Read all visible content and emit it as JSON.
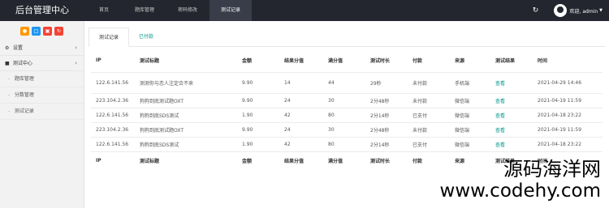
{
  "header": {
    "brand": "后台管理中心",
    "nav": [
      {
        "label": "首页",
        "active": false
      },
      {
        "label": "题库管理",
        "active": false
      },
      {
        "label": "密码修改",
        "active": false
      },
      {
        "label": "测试记录",
        "active": true
      }
    ],
    "user": "欢迎, admin",
    "refresh_icon": "refresh-icon",
    "avatar_icon": "avatar-icon"
  },
  "sidebar": {
    "quick_buttons": [
      {
        "icon": "user-icon",
        "color": "#ff9800"
      },
      {
        "icon": "document-icon",
        "color": "#2196f3"
      },
      {
        "icon": "copy-icon",
        "color": "#f44336"
      },
      {
        "icon": "refresh-icon",
        "color": "#f44336"
      }
    ],
    "menu": [
      {
        "label": "设置",
        "icon": "gears-icon"
      },
      {
        "label": "测试中心",
        "icon": "book-icon"
      }
    ],
    "sub_items": [
      {
        "label": "题库管理"
      },
      {
        "label": "分数管理"
      },
      {
        "label": "测试记录"
      }
    ]
  },
  "tabs": [
    {
      "label": "测试记录",
      "active": true
    },
    {
      "label": "已付款",
      "active": false
    }
  ],
  "table": {
    "headers": [
      "IP",
      "测试标题",
      "金额",
      "结果分值",
      "满分值",
      "测试时长",
      "付款",
      "来源",
      "测试结果",
      "时间"
    ],
    "rows": [
      [
        "122.6.141.56",
        "测测你与恋人注定合不来",
        "9.90",
        "14",
        "44",
        "29秒",
        "未付款",
        "手机端",
        "查看",
        "2021-04-29 14:46"
      ],
      [
        "223.104.2.36",
        "狗狗到底测试题OXT",
        "9.90",
        "24",
        "30",
        "2分48秒",
        "未付款",
        "微信端",
        "查看",
        "2021-04-19 11:59"
      ],
      [
        "122.6.141.56",
        "狗狗到底SDS测试",
        "1.90",
        "42",
        "80",
        "2分14秒",
        "已支付",
        "微信端",
        "查看",
        "2021-04-18 23:22"
      ],
      [
        "223.104.2.36",
        "狗狗到底测试题OXT",
        "9.90",
        "24",
        "30",
        "2分48秒",
        "未付款",
        "微信端",
        "查看",
        "2021-04-19 11:59"
      ],
      [
        "122.6.141.56",
        "狗狗到底SDS测试",
        "1.90",
        "42",
        "80",
        "2分14秒",
        "已支付",
        "微信端",
        "查看",
        "2021-04-18 23:22"
      ]
    ]
  },
  "watermark": {
    "line1": "源码海洋网",
    "line2": "www.codehy.com"
  }
}
